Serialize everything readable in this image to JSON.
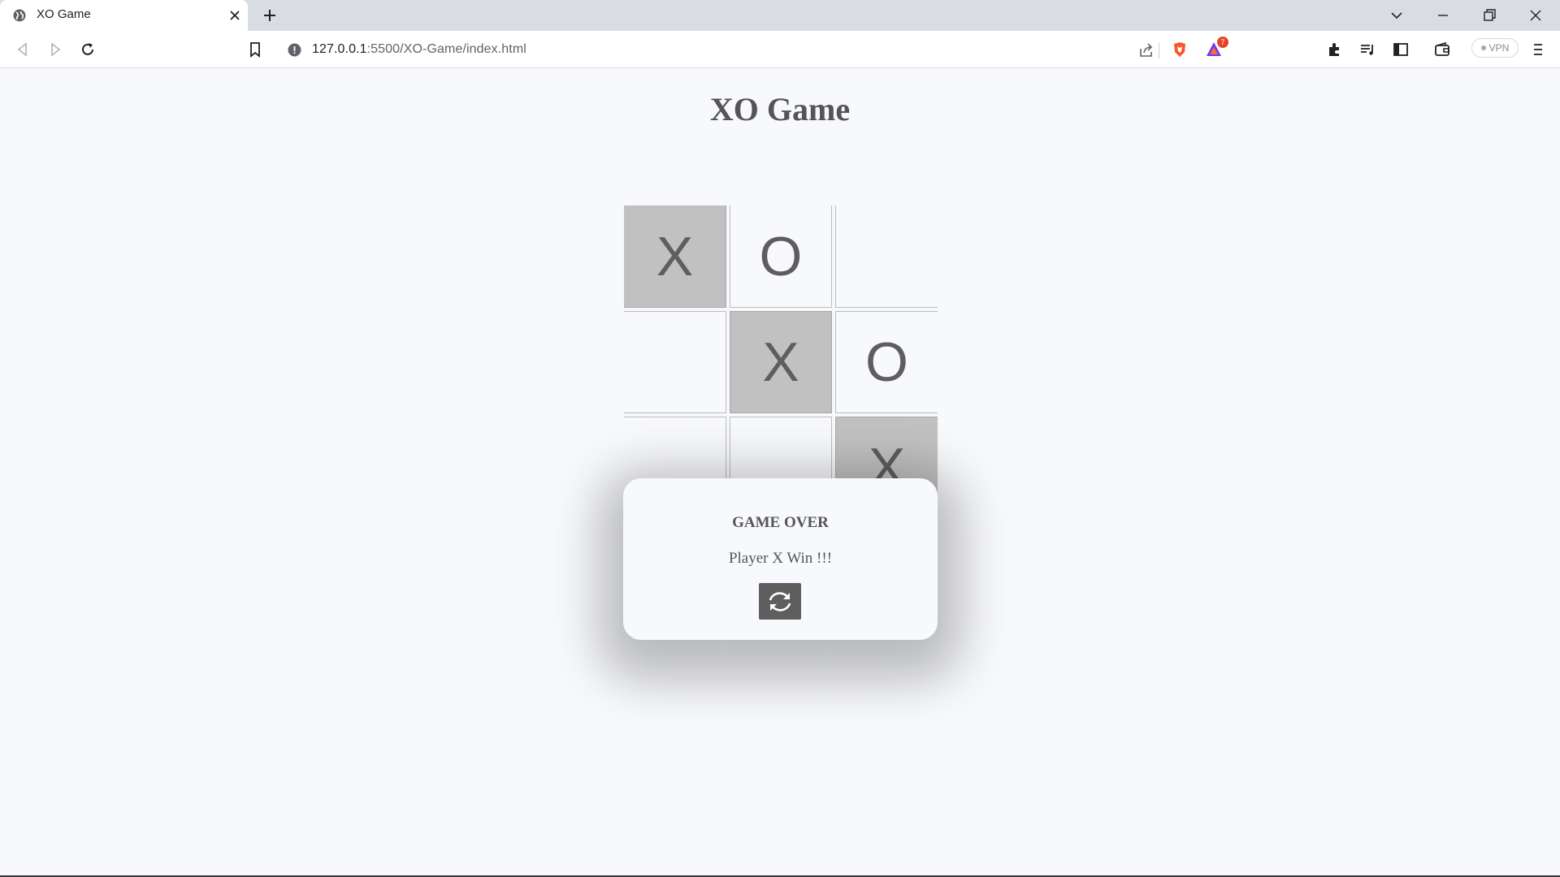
{
  "browser": {
    "tab_title": "XO Game",
    "url_host": "127.0.0.1",
    "url_rest": ":5500/XO-Game/index.html",
    "vpn_label": "VPN",
    "notification_count": "7"
  },
  "page": {
    "title": "XO Game"
  },
  "board": {
    "cells": [
      "X",
      "O",
      "",
      "",
      "X",
      "O",
      "",
      "",
      "X"
    ],
    "winning_cells": [
      0,
      4,
      8
    ]
  },
  "modal": {
    "title": "GAME OVER",
    "message": "Player X Win !!!"
  },
  "colors": {
    "background": "#f8f9fd",
    "win_cell": "#c1c1c1",
    "text": "#555555",
    "button": "#5e5e5e"
  }
}
